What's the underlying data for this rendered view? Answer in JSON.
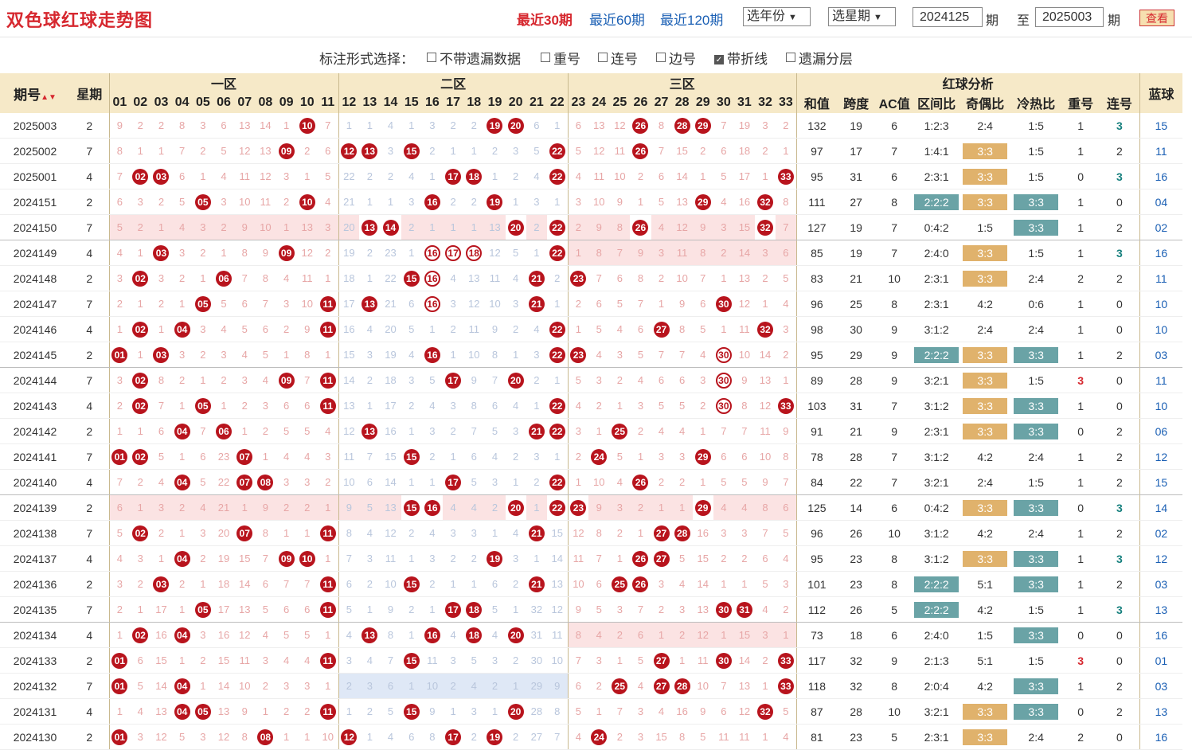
{
  "header": {
    "title": "双色球红球走势图",
    "nav": [
      {
        "label": "最近30期",
        "active": true
      },
      {
        "label": "最近60期",
        "active": false
      },
      {
        "label": "最近120期",
        "active": false
      }
    ],
    "year_select": "选年份",
    "week_select": "选星期",
    "from_value": "2024125",
    "period_label1": "期",
    "to_label": "至",
    "to_value": "2025003",
    "period_label2": "期",
    "query_button": "查看"
  },
  "options": {
    "label": "标注形式选择：",
    "items": [
      {
        "label": "不带遗漏数据",
        "checked": false
      },
      {
        "label": "重号",
        "checked": false
      },
      {
        "label": "连号",
        "checked": false
      },
      {
        "label": "边号",
        "checked": false
      },
      {
        "label": "带折线",
        "checked": true
      },
      {
        "label": "遗漏分层",
        "checked": false
      }
    ]
  },
  "table": {
    "headers": {
      "period": "期号",
      "sort_icon": "▲▼",
      "week": "星期",
      "zones": [
        "一区",
        "二区",
        "三区"
      ],
      "analysis": "红球分析",
      "blue": "蓝球",
      "numbers": [
        "01",
        "02",
        "03",
        "04",
        "05",
        "06",
        "07",
        "08",
        "09",
        "10",
        "11",
        "12",
        "13",
        "14",
        "15",
        "16",
        "17",
        "18",
        "19",
        "20",
        "21",
        "22",
        "23",
        "24",
        "25",
        "26",
        "27",
        "28",
        "29",
        "30",
        "31",
        "32",
        "33"
      ],
      "analysis_cols": [
        "和值",
        "跨度",
        "AC值",
        "区间比",
        "奇偶比",
        "冷热比",
        "重号",
        "连号"
      ]
    },
    "rows": [
      {
        "period": "2025003",
        "week": "2",
        "balls": [
          10,
          19,
          20,
          26,
          28,
          29
        ],
        "rings": [],
        "miss": "9 2 2 8 3 6 13 14 1 _ 7 1 1 4 1 3 2 2 _ _ 6 1 6 13 12 _ 8 _ _ 7 19 3 2",
        "sum": "132",
        "span": "19",
        "ac": "6",
        "zone": "1:2:3",
        "oe": "2:4",
        "ch": "1:5",
        "rep": "1",
        "con": "3",
        "blue": "15"
      },
      {
        "period": "2025002",
        "week": "7",
        "balls": [
          9,
          12,
          13,
          15,
          22,
          26
        ],
        "rings": [],
        "miss": "8 1 1 7 2 5 12 13 _ 2 6 _ _ 3 _ 2 1 1 2 3 5 _ 5 12 11 _ 7 15 2 6 18 2 1",
        "sum": "97",
        "span": "17",
        "ac": "7",
        "zone": "1:4:1",
        "oe": "3:3",
        "ch": "1:5",
        "rep": "1",
        "con": "2",
        "blue": "11"
      },
      {
        "period": "2025001",
        "week": "4",
        "balls": [
          2,
          3,
          17,
          18,
          22,
          33
        ],
        "rings": [],
        "miss": "7 _ _ 6 1 4 11 12 3 1 5 22 2 2 4 1 _ _ 1 2 4 _ 4 11 10 2 6 14 1 5 17 1 _",
        "sum": "95",
        "span": "31",
        "ac": "6",
        "zone": "2:3:1",
        "oe": "3:3",
        "ch": "1:5",
        "rep": "0",
        "con": "3",
        "blue": "16"
      },
      {
        "period": "2024151",
        "week": "2",
        "balls": [
          5,
          10,
          16,
          19,
          29,
          32
        ],
        "rings": [],
        "miss": "6 3 2 5 _ 3 10 11 2 _ 4 21 1 1 3 _ 2 2 _ 1 3 1 3 10 9 1 5 13 _ 4 16 _ 8",
        "sum": "111",
        "span": "27",
        "ac": "8",
        "zone": "2:2:2",
        "oe": "3:3",
        "ch": "3:3",
        "rep": "1",
        "con": "0",
        "blue": "04"
      },
      {
        "period": "2024150",
        "week": "7",
        "balls": [
          13,
          14,
          20,
          22,
          26,
          32
        ],
        "rings": [],
        "miss": "5 2 1 4 3 2 9 10 1 13 3 20 _ _ 2 1 1 1 13 _ 2 _ 2 9 8 _ 4 12 9 3 15 _ 7",
        "sum": "127",
        "span": "19",
        "ac": "7",
        "zone": "0:4:2",
        "oe": "1:5",
        "ch": "3:3",
        "rep": "1",
        "con": "2",
        "blue": "02",
        "pink": true,
        "grp": true
      },
      {
        "period": "2024149",
        "week": "4",
        "balls": [
          3,
          9,
          16,
          17,
          18,
          22
        ],
        "rings": [
          16,
          17,
          18
        ],
        "miss": "4 1 _ 3 2 1 8 9 _ 12 2 19 2 23 1 _ _ _ 12 5 1 _ 1 8 7 9 3 11 8 2 14 3 6",
        "sum": "85",
        "span": "19",
        "ac": "7",
        "zone": "2:4:0",
        "oe": "3:3",
        "ch": "1:5",
        "rep": "1",
        "con": "3",
        "blue": "16",
        "pink3": true
      },
      {
        "period": "2024148",
        "week": "2",
        "balls": [
          2,
          6,
          15,
          16,
          21,
          23
        ],
        "rings": [
          16
        ],
        "miss": "3 _ 3 2 1 _ 7 8 4 11 1 18 1 22 _ _ 4 13 11 4 _ 2 _ 7 6 8 2 10 7 1 13 2 5",
        "sum": "83",
        "span": "21",
        "ac": "10",
        "zone": "2:3:1",
        "oe": "3:3",
        "ch": "2:4",
        "rep": "2",
        "con": "2",
        "blue": "11"
      },
      {
        "period": "2024147",
        "week": "7",
        "balls": [
          5,
          11,
          13,
          16,
          21,
          30
        ],
        "rings": [
          16
        ],
        "miss": "2 1 2 1 _ 5 6 7 3 10 _ 17 _ 21 6 _ 3 12 10 3 _ 1 2 6 5 7 1 9 6 _ 12 1 4",
        "sum": "96",
        "span": "25",
        "ac": "8",
        "zone": "2:3:1",
        "oe": "4:2",
        "ch": "0:6",
        "rep": "1",
        "con": "0",
        "blue": "10"
      },
      {
        "period": "2024146",
        "week": "4",
        "balls": [
          2,
          4,
          11,
          22,
          27,
          32
        ],
        "rings": [],
        "miss": "1 _ 1 _ 3 4 5 6 2 9 _ 16 4 20 5 1 2 11 9 2 4 _ 1 5 4 6 _ 8 5 1 11 _ 3",
        "sum": "98",
        "span": "30",
        "ac": "9",
        "zone": "3:1:2",
        "oe": "2:4",
        "ch": "2:4",
        "rep": "1",
        "con": "0",
        "blue": "10"
      },
      {
        "period": "2024145",
        "week": "2",
        "balls": [
          1,
          3,
          16,
          22,
          23,
          30
        ],
        "rings": [
          30
        ],
        "miss": "_ 1 _ 3 2 3 4 5 1 8 1 15 3 19 4 _ 1 10 8 1 3 _ _ 4 3 5 7 7 4 _ 10 14 2",
        "sum": "95",
        "span": "29",
        "ac": "9",
        "zone": "2:2:2",
        "oe": "3:3",
        "ch": "3:3",
        "rep": "1",
        "con": "2",
        "blue": "03",
        "grp": true
      },
      {
        "period": "2024144",
        "week": "7",
        "balls": [
          2,
          9,
          11,
          17,
          20,
          30
        ],
        "rings": [
          30
        ],
        "miss": "3 _ 8 2 1 2 3 4 _ 7 _ 14 2 18 3 5 _ 9 7 _ 2 1 5 3 2 4 6 6 3 _ 9 13 1",
        "sum": "89",
        "span": "28",
        "ac": "9",
        "zone": "3:2:1",
        "oe": "3:3",
        "ch": "1:5",
        "rep": "3",
        "con": "0",
        "blue": "11"
      },
      {
        "period": "2024143",
        "week": "4",
        "balls": [
          2,
          5,
          11,
          22,
          30,
          33
        ],
        "rings": [
          30
        ],
        "miss": "2 _ 7 1 _ 1 2 3 6 6 _ 13 1 17 2 4 3 8 6 4 1 _ 4 2 1 3 5 5 2 _ 8 12 _",
        "sum": "103",
        "span": "31",
        "ac": "7",
        "zone": "3:1:2",
        "oe": "3:3",
        "ch": "3:3",
        "rep": "1",
        "con": "0",
        "blue": "10"
      },
      {
        "period": "2024142",
        "week": "2",
        "balls": [
          4,
          6,
          13,
          21,
          22,
          25
        ],
        "rings": [],
        "miss": "1 1 6 _ 7 _ 1 2 5 5 4 12 _ 16 1 3 2 7 5 3 _ _ 3 1 _ 2 4 4 1 7 7 11 9",
        "sum": "91",
        "span": "21",
        "ac": "9",
        "zone": "2:3:1",
        "oe": "3:3",
        "ch": "3:3",
        "rep": "0",
        "con": "2",
        "blue": "06"
      },
      {
        "period": "2024141",
        "week": "7",
        "balls": [
          1,
          2,
          7,
          15,
          24,
          29
        ],
        "rings": [],
        "miss": "_ _ 5 1 6 23 _ 1 4 4 3 11 7 15 _ 2 1 6 4 2 3 1 2 _ 5 1 3 3 _ 6 6 10 8",
        "sum": "78",
        "span": "28",
        "ac": "7",
        "zone": "3:1:2",
        "oe": "4:2",
        "ch": "2:4",
        "rep": "1",
        "con": "2",
        "blue": "12"
      },
      {
        "period": "2024140",
        "week": "4",
        "balls": [
          4,
          7,
          8,
          17,
          22,
          26
        ],
        "rings": [],
        "miss": "7 2 4 _ 5 22 _ _ 3 3 2 10 6 14 1 1 _ 5 3 1 2 _ 1 10 4 _ 2 2 1 5 5 9 7",
        "sum": "84",
        "span": "22",
        "ac": "7",
        "zone": "3:2:1",
        "oe": "2:4",
        "ch": "1:5",
        "rep": "1",
        "con": "2",
        "blue": "15",
        "grp": true
      },
      {
        "period": "2024139",
        "week": "2",
        "balls": [
          15,
          16,
          20,
          22,
          23,
          29
        ],
        "rings": [],
        "miss": "6 1 3 2 4 21 1 9 2 2 1 9 5 13 _ _ 4 4 2 _ 1 _ _ 9 3 2 1 1 _ 4 4 8 6",
        "sum": "125",
        "span": "14",
        "ac": "6",
        "zone": "0:4:2",
        "oe": "3:3",
        "ch": "3:3",
        "rep": "0",
        "con": "3",
        "blue": "14",
        "pink": true
      },
      {
        "period": "2024138",
        "week": "7",
        "balls": [
          2,
          7,
          11,
          21,
          27,
          28
        ],
        "rings": [],
        "miss": "5 _ 2 1 3 20 _ 8 1 1 _ 8 4 12 2 4 3 3 1 4 _ 15 12 8 2 1 _ _ 16 3 3 7 5",
        "sum": "96",
        "span": "26",
        "ac": "10",
        "zone": "3:1:2",
        "oe": "4:2",
        "ch": "2:4",
        "rep": "1",
        "con": "2",
        "blue": "02"
      },
      {
        "period": "2024137",
        "week": "4",
        "balls": [
          4,
          9,
          10,
          19,
          26,
          27
        ],
        "rings": [],
        "miss": "4 3 1 _ 2 19 15 7 _ _ 1 7 3 11 1 3 2 2 _ 3 1 14 11 7 1 _ _ 5 15 2 2 6 4",
        "sum": "95",
        "span": "23",
        "ac": "8",
        "zone": "3:1:2",
        "oe": "3:3",
        "ch": "3:3",
        "rep": "1",
        "con": "3",
        "blue": "12"
      },
      {
        "period": "2024136",
        "week": "2",
        "balls": [
          3,
          11,
          15,
          21,
          25,
          26
        ],
        "rings": [],
        "miss": "3 2 _ 2 1 18 14 6 7 7 _ 6 2 10 _ 2 1 1 6 2 _ 13 10 6 _ _ 3 4 14 1 1 5 3",
        "sum": "101",
        "span": "23",
        "ac": "8",
        "zone": "2:2:2",
        "oe": "5:1",
        "ch": "3:3",
        "rep": "1",
        "con": "2",
        "blue": "03"
      },
      {
        "period": "2024135",
        "week": "7",
        "balls": [
          5,
          11,
          17,
          18,
          30,
          31
        ],
        "rings": [],
        "miss": "2 1 17 1 _ 17 13 5 6 6 _ 5 1 9 2 1 _ _ 5 1 32 12 9 5 3 7 2 3 13 _ _ 4 2",
        "sum": "112",
        "span": "26",
        "ac": "5",
        "zone": "2:2:2",
        "oe": "4:2",
        "ch": "1:5",
        "rep": "1",
        "con": "3",
        "blue": "13",
        "grp": true
      },
      {
        "period": "2024134",
        "week": "4",
        "balls": [
          2,
          4,
          13,
          16,
          18,
          20
        ],
        "rings": [],
        "miss": "1 _ 16 _ 3 16 12 4 5 5 1 4 _ 8 1 _ 4 _ 4 _ 31 11 8 4 2 6 1 2 12 1 15 3 1",
        "sum": "73",
        "span": "18",
        "ac": "6",
        "zone": "2:4:0",
        "oe": "1:5",
        "ch": "3:3",
        "rep": "0",
        "con": "0",
        "blue": "16",
        "pink3": true
      },
      {
        "period": "2024133",
        "week": "2",
        "balls": [
          1,
          11,
          15,
          27,
          30,
          33
        ],
        "rings": [],
        "miss": "_ 6 15 1 2 15 11 3 4 4 _ 3 4 7 _ 11 3 5 3 2 30 10 7 3 1 5 _ 1 11 _ 14 2 _",
        "sum": "117",
        "span": "32",
        "ac": "9",
        "zone": "2:1:3",
        "oe": "5:1",
        "ch": "1:5",
        "rep": "3",
        "con": "0",
        "blue": "01"
      },
      {
        "period": "2024132",
        "week": "7",
        "balls": [
          1,
          4,
          25,
          27,
          28,
          33
        ],
        "rings": [],
        "miss": "_ 5 14 _ 1 14 10 2 3 3 1 2 3 6 1 10 2 4 2 1 29 9 6 2 _ 4 _ _ 10 7 13 1 _",
        "sum": "118",
        "span": "32",
        "ac": "8",
        "zone": "2:0:4",
        "oe": "4:2",
        "ch": "3:3",
        "rep": "1",
        "con": "2",
        "blue": "03",
        "bluebg": true
      },
      {
        "period": "2024131",
        "week": "4",
        "balls": [
          4,
          5,
          11,
          15,
          20,
          32
        ],
        "rings": [],
        "miss": "1 4 13 _ _ 13 9 1 2 2 _ 1 2 5 _ 9 1 3 1 _ 28 8 5 1 7 3 4 16 9 6 12 _ 5",
        "sum": "87",
        "span": "28",
        "ac": "10",
        "zone": "3:2:1",
        "oe": "3:3",
        "ch": "3:3",
        "rep": "0",
        "con": "2",
        "blue": "13"
      },
      {
        "period": "2024130",
        "week": "2",
        "balls": [
          1,
          8,
          12,
          17,
          19,
          24
        ],
        "rings": [],
        "miss": "_ 3 12 5 3 12 8 _ 1 1 10 _ 1 4 6 8 _ 2 _ 2 27 7 4 _ 2 3 15 8 5 11 11 1 4",
        "sum": "81",
        "span": "23",
        "ac": "5",
        "zone": "2:3:1",
        "oe": "3:3",
        "ch": "2:4",
        "rep": "2",
        "con": "0",
        "blue": "16"
      }
    ]
  },
  "colors": {
    "red_ball": "#b8141d",
    "accent_red": "#d6282f",
    "link_blue": "#1a5fb4",
    "header_bg": "#f6e9c8",
    "gold_tag": "#e0b26c",
    "teal_tag": "#6aa3a6"
  }
}
